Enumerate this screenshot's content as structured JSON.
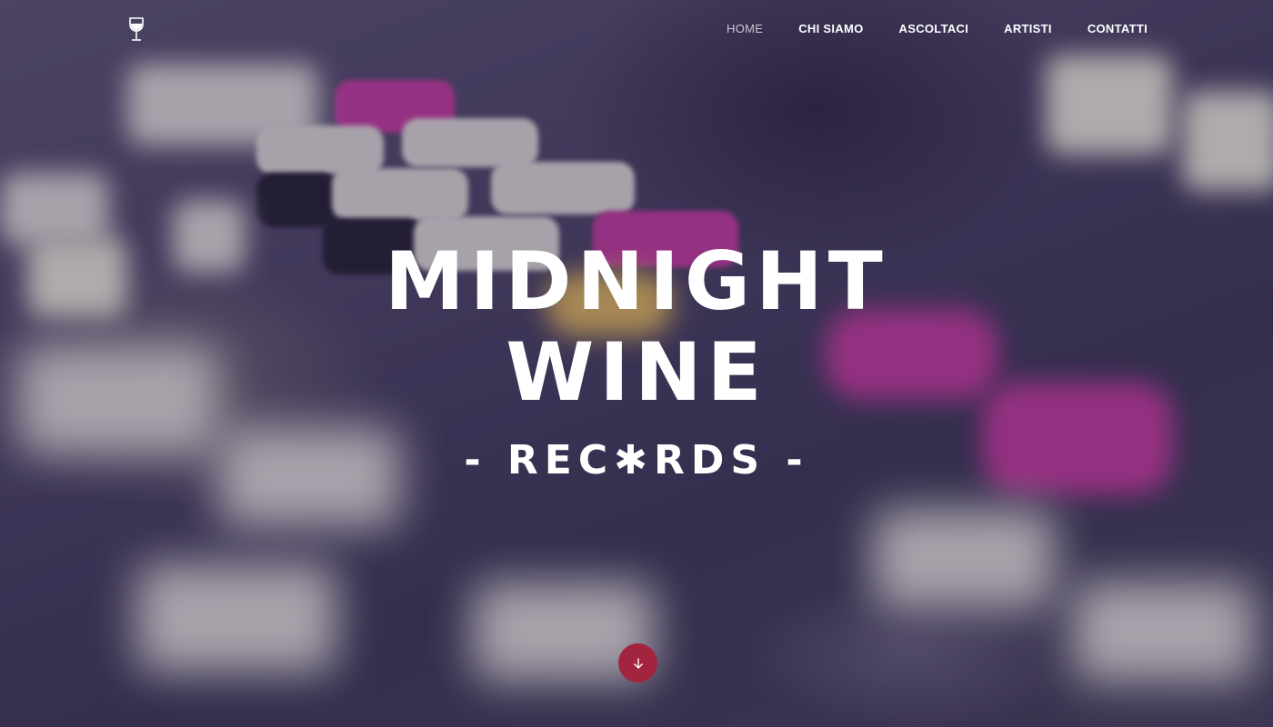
{
  "nav": {
    "items": [
      {
        "label": "HOME",
        "active": true
      },
      {
        "label": "CHI SIAMO",
        "active": false
      },
      {
        "label": "ASCOLTACI",
        "active": false
      },
      {
        "label": "ARTISTI",
        "active": false
      },
      {
        "label": "CONTATTI",
        "active": false
      }
    ],
    "logo_icon": "wine-glass-icon"
  },
  "hero": {
    "title_line1": "MIDNIGHT",
    "title_line2": "WINE",
    "subtitle": "- REC✱RDS -",
    "scroll_icon": "arrow-down-icon"
  },
  "colors": {
    "accent": "#a3243f",
    "text": "#ffffff",
    "active_nav": "#c9c6cf"
  }
}
